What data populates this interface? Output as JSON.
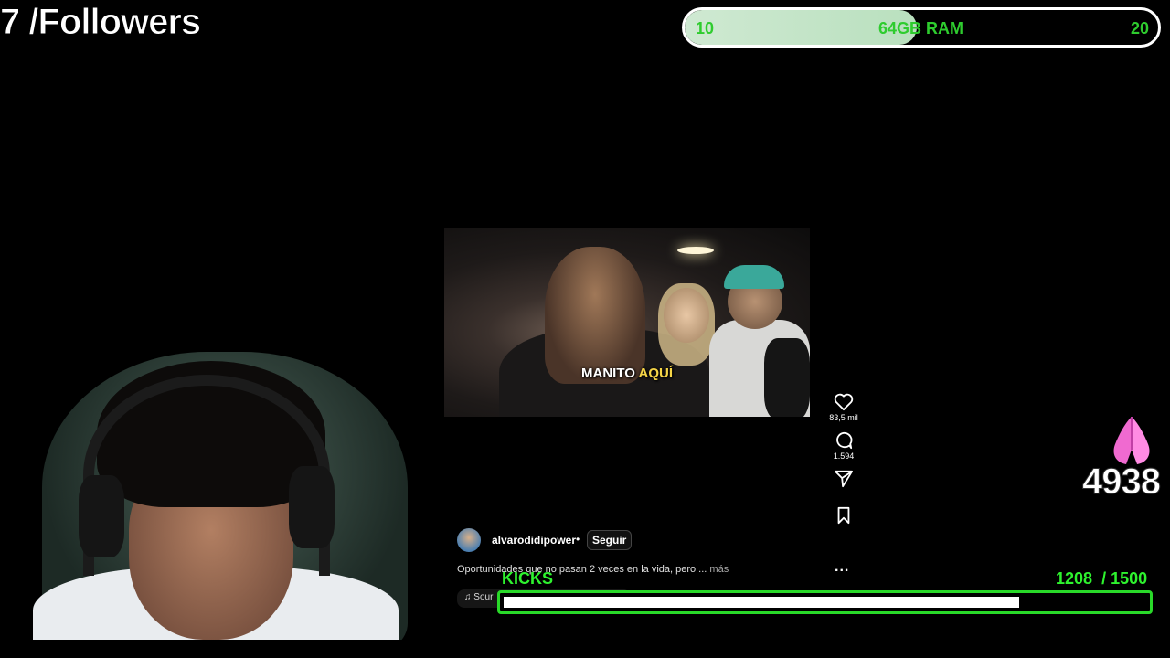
{
  "overlay": {
    "followers_label": "7 /Followers",
    "ram_bar": {
      "min_label": "10",
      "center_label": "64GB RAM",
      "max_label": "20",
      "fill_fraction": 0.49,
      "fill_color": "#cfe9d2",
      "text_color": "#2ecc2e"
    },
    "kicks": {
      "label": "KICKS",
      "current": "1208",
      "goal": "/ 1500",
      "progress_fraction": 0.805,
      "bar_color": "#29d929"
    },
    "score_text": "4938",
    "praying_hands_icon": "praying-hands-icon"
  },
  "video_post": {
    "caption_plain": "MANITO ",
    "caption_highlight": "AQUÍ",
    "actions": {
      "like_count": "83,5 mil",
      "comment_count": "1.594"
    },
    "username": "alvarodidipower",
    "separator": "•",
    "follow_label": "Seguir",
    "description": "Oportunidades que no pasan 2 veces en la vida, pero ...",
    "more_label": "más",
    "sound_label": "Sour",
    "more_options_label": "..."
  },
  "colors": {
    "background": "#000000",
    "accent_green": "#2ef22e",
    "caption_yellow": "#f5d547"
  }
}
